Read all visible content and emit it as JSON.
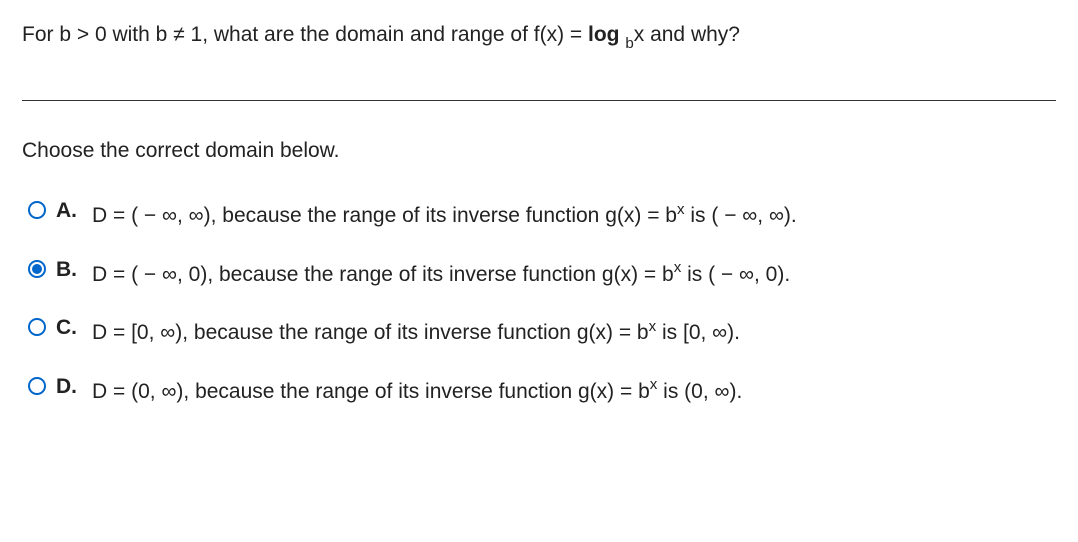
{
  "question": {
    "p1": "For b > 0 with b ≠ 1, what are the domain and range of f(x) = ",
    "log_bold": "log ",
    "log_sub": "b",
    "p2": "x and why?"
  },
  "instruction": "Choose the correct domain below.",
  "options": [
    {
      "label": "A.",
      "selected": false,
      "pre": "D = ( − ∞, ∞), because the range of its inverse function g(x) = b",
      "exp": "x",
      "post": " is ( − ∞, ∞)."
    },
    {
      "label": "B.",
      "selected": true,
      "pre": "D = ( − ∞, 0), because the range of its inverse function g(x) = b",
      "exp": "x",
      "post": " is ( − ∞, 0)."
    },
    {
      "label": "C.",
      "selected": false,
      "pre": "D = [0, ∞), because the range of its inverse function g(x) = b",
      "exp": "x",
      "post": " is [0, ∞)."
    },
    {
      "label": "D.",
      "selected": false,
      "pre": "D = (0, ∞), because the range of its inverse function g(x) = b",
      "exp": "x",
      "post": " is (0, ∞)."
    }
  ]
}
